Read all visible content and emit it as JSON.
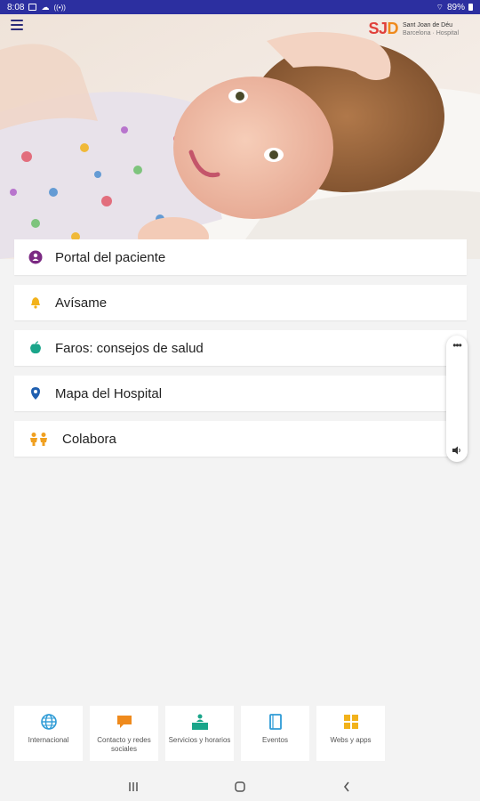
{
  "status_bar": {
    "time": "8:08",
    "battery": "89%",
    "left_icons": [
      "image-icon",
      "cloud-icon",
      "signal-strength-icon"
    ],
    "right_icons": [
      "wifi-icon",
      "battery-icon"
    ]
  },
  "header": {
    "brand_mark_s": "S",
    "brand_mark_j": "J",
    "brand_mark_d": "D",
    "brand_name": "Sant Joan de Déu",
    "brand_sub": "Barcelona · Hospital"
  },
  "menu": [
    {
      "label": "Portal del paciente",
      "icon": "person-icon",
      "color": "#7b2a83"
    },
    {
      "label": "Avísame",
      "icon": "bell-icon",
      "color": "#f2b21b"
    },
    {
      "label": "Faros: consejos de salud",
      "icon": "apple-icon",
      "color": "#1aa58a"
    },
    {
      "label": "Mapa del Hospital",
      "icon": "map-pin-icon",
      "color": "#1f5fb0"
    },
    {
      "label": "Colabora",
      "icon": "people-icon",
      "color": "#f0a020"
    }
  ],
  "bottom_tabs": [
    {
      "label": "Internacional",
      "icon": "globe-icon",
      "color": "#2e9bd6"
    },
    {
      "label": "Contacto y redes sociales",
      "icon": "chat-bubble-icon",
      "color": "#ef8a1c"
    },
    {
      "label": "Servicios y horarios",
      "icon": "desk-person-icon",
      "color": "#1aa58a"
    },
    {
      "label": "Eventos",
      "icon": "notebook-icon",
      "color": "#2e9bd6"
    },
    {
      "label": "Webs y apps",
      "icon": "grid-apps-icon",
      "color": "#f2b21b"
    }
  ],
  "colors": {
    "status_bar": "#2c2fa0",
    "brand_red": "#e0403a",
    "brand_orange": "#ef8a1c"
  }
}
